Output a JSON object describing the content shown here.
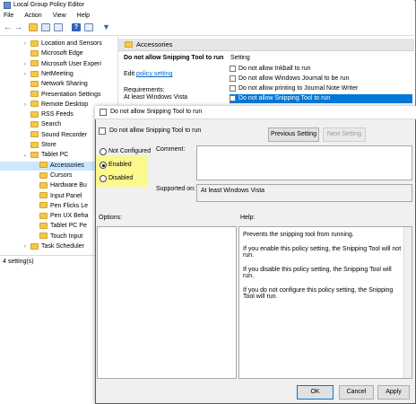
{
  "gpe": {
    "title": "Local Group Policy Editor",
    "menu": [
      "File",
      "Action",
      "View",
      "Help"
    ],
    "tree": [
      {
        "label": "Location and Sensors",
        "indent": 1,
        "expand": "›"
      },
      {
        "label": "Microsoft Edge",
        "indent": 1,
        "expand": ""
      },
      {
        "label": "Microsoft User Experi",
        "indent": 1,
        "expand": "›"
      },
      {
        "label": "NetMeeting",
        "indent": 1,
        "expand": "›"
      },
      {
        "label": "Network Sharing",
        "indent": 1,
        "expand": ""
      },
      {
        "label": "Presentation Settings",
        "indent": 1,
        "expand": ""
      },
      {
        "label": "Remote Desktop",
        "indent": 1,
        "expand": "›"
      },
      {
        "label": "RSS Feeds",
        "indent": 1,
        "expand": ""
      },
      {
        "label": "Search",
        "indent": 1,
        "expand": ""
      },
      {
        "label": "Sound Recorder",
        "indent": 1,
        "expand": ""
      },
      {
        "label": "Store",
        "indent": 1,
        "expand": ""
      },
      {
        "label": "Tablet PC",
        "indent": 1,
        "expand": "⌄"
      },
      {
        "label": "Accessories",
        "indent": 2,
        "expand": "",
        "selected": true
      },
      {
        "label": "Cursors",
        "indent": 2,
        "expand": ""
      },
      {
        "label": "Hardware Bu",
        "indent": 2,
        "expand": ""
      },
      {
        "label": "Input Panel",
        "indent": 2,
        "expand": ""
      },
      {
        "label": "Pen Flicks Le",
        "indent": 2,
        "expand": ""
      },
      {
        "label": "Pen UX Beha",
        "indent": 2,
        "expand": ""
      },
      {
        "label": "Tablet PC Pe",
        "indent": 2,
        "expand": ""
      },
      {
        "label": "Touch Input",
        "indent": 2,
        "expand": ""
      },
      {
        "label": "Task Scheduler",
        "indent": 1,
        "expand": "›"
      }
    ],
    "status": "4 setting(s)",
    "category": "Accessories",
    "detail_title": "Do not allow Snipping Tool to run",
    "edit_prefix": "Edit",
    "edit_link": "policy setting",
    "requirements_label": "Requirements:",
    "requirements_value": "At least Windows Vista",
    "settings_header": "Setting",
    "settings": [
      {
        "label": "Do not allow Inkball to run",
        "selected": false
      },
      {
        "label": "Do not allow Windows Journal to be run",
        "selected": false
      },
      {
        "label": "Do not allow printing to Journal Note Writer",
        "selected": false
      },
      {
        "label": "Do not allow Snipping Tool to run",
        "selected": true
      }
    ]
  },
  "dialog": {
    "title": "Do not allow Snipping Tool to run",
    "policy_name": "Do not allow Snipping Tool to run",
    "prev_button": "Previous Setting",
    "next_button": "Next Setting",
    "radios": [
      {
        "label": "Not Configured",
        "checked": false
      },
      {
        "label": "Enabled",
        "checked": true
      },
      {
        "label": "Disabled",
        "checked": false
      }
    ],
    "comment_label": "Comment:",
    "supported_label": "Supported on:",
    "supported_value": "At least Windows Vista",
    "options_label": "Options:",
    "help_label": "Help:",
    "help_paragraphs": [
      "Prevents the snipping tool from running.",
      "If you enable this policy setting, the Snipping Tool will not run.",
      "If you disable this policy setting, the Snipping Tool will run.",
      "If you do not configure this policy setting, the Snipping Tool will run."
    ],
    "ok": "OK",
    "cancel": "Cancel",
    "apply": "Apply"
  },
  "colors": {
    "selection": "#0078d7",
    "highlight_yellow": "#fbf98d",
    "link": "#0066cc"
  },
  "icons": [
    "back-icon",
    "forward-icon",
    "folder-up-icon",
    "show-hide-tree-icon",
    "export-icon",
    "help-icon",
    "properties-icon",
    "filter-icon",
    "policy-setting-icon"
  ]
}
